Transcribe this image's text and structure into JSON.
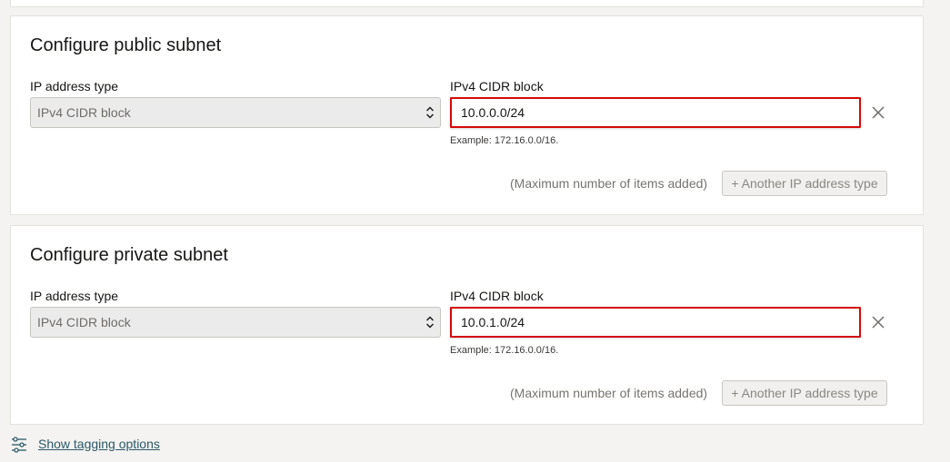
{
  "public_subnet": {
    "title": "Configure public subnet",
    "ip_type_label": "IP address type",
    "ip_type_value": "IPv4 CIDR block",
    "cidr_label": "IPv4 CIDR block",
    "cidr_value": "10.0.0.0/24",
    "example": "Example: 172.16.0.0/16.",
    "max_note": "(Maximum number of items added)",
    "add_button": "+ Another IP address type"
  },
  "private_subnet": {
    "title": "Configure private subnet",
    "ip_type_label": "IP address type",
    "ip_type_value": "IPv4 CIDR block",
    "cidr_label": "IPv4 CIDR block",
    "cidr_value": "10.0.1.0/24",
    "example": "Example: 172.16.0.0/16.",
    "max_note": "(Maximum number of items added)",
    "add_button": "+ Another IP address type"
  },
  "footer": {
    "tagging_link": "Show tagging options",
    "icon": "sliders-icon"
  },
  "colors": {
    "highlight_border": "#d30a0a",
    "link": "#2c5967",
    "page_bg": "#f4f3f1"
  }
}
